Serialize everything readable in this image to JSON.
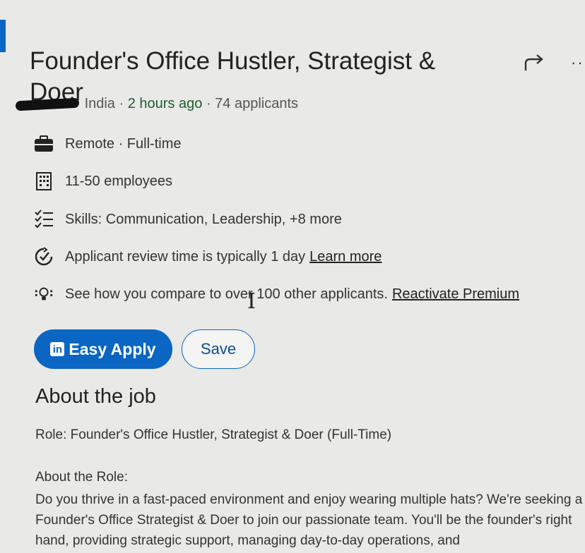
{
  "job": {
    "title": "Founder's Office Hustler, Strategist & Doer",
    "location": "India",
    "posted": "2 hours ago",
    "applicants": "74 applicants"
  },
  "insights": {
    "workplace": "Remote · Full-time",
    "company_size": "11-50 employees",
    "skills": "Skills: Communication, Leadership, +8 more",
    "review_time": "Applicant review time is typically 1 day",
    "review_link": "Learn more",
    "compare": "See how you compare to over 100 other applicants.",
    "premium_link": "Reactivate Premium"
  },
  "actions": {
    "easy_apply": "Easy Apply",
    "save": "Save",
    "in_logo": "in"
  },
  "about": {
    "heading": "About the job",
    "role_label": "Role:",
    "role_value": "Founder's Office Hustler, Strategist & Doer (Full-Time)",
    "about_role_heading": "About the Role:",
    "description": "Do you thrive in a fast-paced environment and enjoy wearing multiple hats? We're seeking a Founder's Office Strategist & Doer to join our passionate team. You'll be the founder's right hand, providing strategic support, managing day-to-day operations, and"
  },
  "icons": [
    "share-icon",
    "more-icon",
    "briefcase-icon",
    "building-icon",
    "checklist-icon",
    "review-time-icon",
    "lightbulb-icon",
    "text-cursor-icon"
  ],
  "colors": {
    "brand": "#0a66c2",
    "posted_green": "#1f5e2e"
  }
}
